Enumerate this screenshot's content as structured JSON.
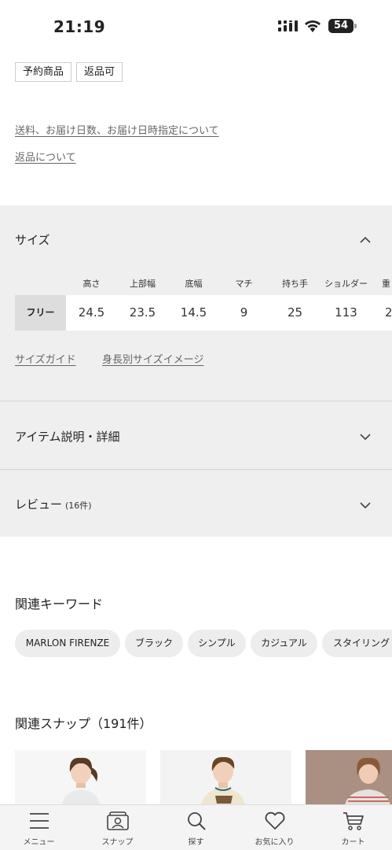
{
  "status_bar": {
    "time": "21:19",
    "battery": "54"
  },
  "tags": [
    "予約商品",
    "返品可"
  ],
  "links": {
    "shipping": "送料、お届け日数、お届け日時指定について",
    "returns": "返品について"
  },
  "size_section": {
    "title": "サイズ",
    "columns": [
      "高さ",
      "上部幅",
      "底幅",
      "マチ",
      "持ち手",
      "ショルダー",
      "重"
    ],
    "row_label": "フリー",
    "values": [
      "24.5",
      "23.5",
      "14.5",
      "9",
      "25",
      "113",
      "2"
    ],
    "size_guide": "サイズガイド",
    "height_size_image": "身長別サイズイメージ"
  },
  "item_detail": {
    "title": "アイテム説明・詳細"
  },
  "review": {
    "title": "レビュー",
    "count": "(16件)"
  },
  "keywords": {
    "title": "関連キーワード",
    "items": [
      "MARLON FIRENZE",
      "ブラック",
      "シンプル",
      "カジュアル",
      "スタイリング"
    ]
  },
  "snaps": {
    "title": "関連スナップ（191件）"
  },
  "bottom_nav": {
    "items": [
      {
        "label": "メニュー",
        "icon": "menu-icon"
      },
      {
        "label": "スナップ",
        "icon": "snap-icon"
      },
      {
        "label": "探す",
        "icon": "search-icon"
      },
      {
        "label": "お気に入り",
        "icon": "heart-icon"
      },
      {
        "label": "カート",
        "icon": "cart-icon"
      }
    ]
  }
}
